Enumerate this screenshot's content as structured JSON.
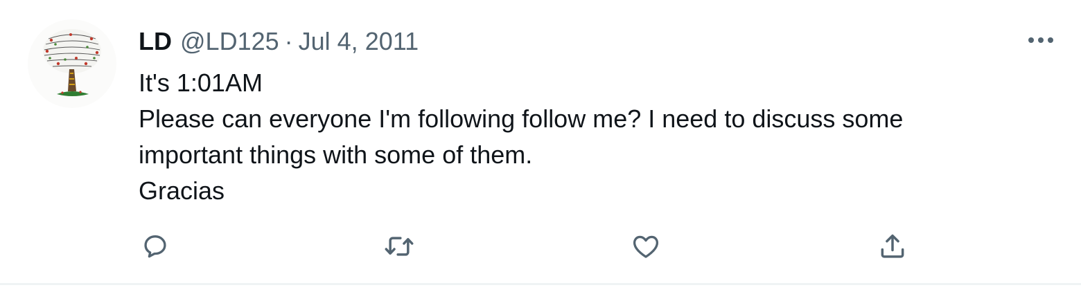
{
  "tweet": {
    "author_name": "LD",
    "author_handle": "@LD125",
    "separator": "·",
    "date": "Jul 4, 2011",
    "lines": [
      "It's 1:01AM",
      "Please can everyone I'm following follow me? I need to discuss some",
      "important things with some of them.",
      "Gracias"
    ]
  },
  "icons": {
    "avatar": "tree-avatar",
    "more": "more-horizontal-icon",
    "reply": "reply-icon",
    "retweet": "retweet-icon",
    "like": "heart-icon",
    "share": "share-icon"
  },
  "colors": {
    "text_primary": "#0f1419",
    "text_secondary": "#536471",
    "divider": "#eff3f4"
  }
}
